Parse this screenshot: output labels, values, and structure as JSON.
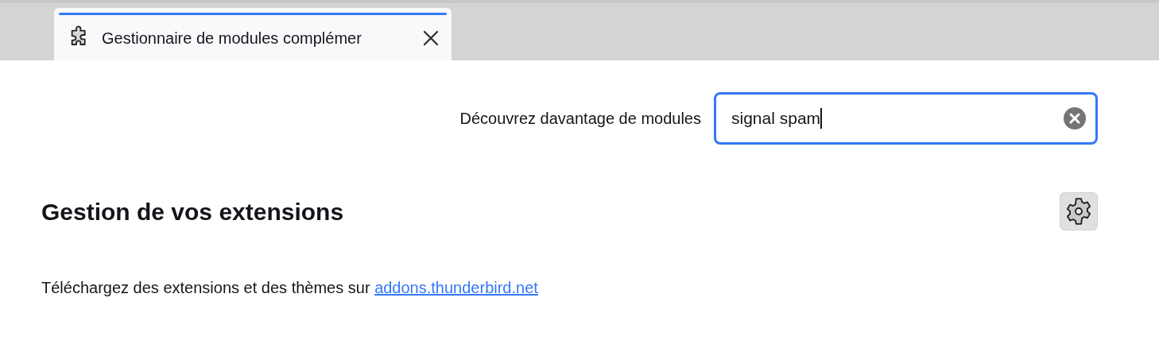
{
  "tab": {
    "title": "Gestionnaire de modules complémer",
    "selected": true
  },
  "search": {
    "label": "Découvrez davantage de modules",
    "value": "signal spam"
  },
  "heading": "Gestion de vos extensions",
  "footer": {
    "text": "Téléchargez des extensions et des thèmes sur",
    "link": "addons.thunderbird.net"
  }
}
